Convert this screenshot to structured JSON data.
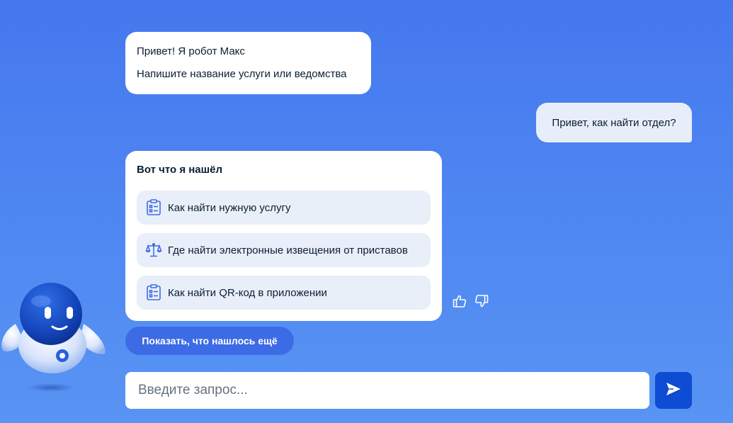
{
  "chat": {
    "bot_greeting": {
      "line1": "Привет! Я робот Макс",
      "line2": "Напишите название услуги или ведомства"
    },
    "user_message": "Привет, как найти отдел?",
    "bot_results": {
      "title": "Вот что я нашёл",
      "items": [
        {
          "label": "Как найти нужную услугу",
          "icon": "clipboard-list-icon"
        },
        {
          "label": "Где найти электронные извещения от приставов",
          "icon": "scales-icon"
        },
        {
          "label": "Как найти QR-код в приложении",
          "icon": "clipboard-list-icon"
        }
      ]
    },
    "feedback": {
      "like_icon": "thumbs-up-icon",
      "dislike_icon": "thumbs-down-icon"
    },
    "show_more_label": "Показать, что нашлось ещё"
  },
  "composer": {
    "placeholder": "Введите запрос...",
    "value": "",
    "send_icon": "send-arrow-icon"
  },
  "assistant": {
    "avatar": "robot-max-avatar"
  },
  "colors": {
    "background_top": "#4577ee",
    "background_bottom": "#5894f3",
    "accent": "#0d4cd3",
    "result_item_bg": "#e9eff9",
    "user_bubble_bg": "#e8eef9",
    "show_more_bg": "#3d6be6"
  }
}
